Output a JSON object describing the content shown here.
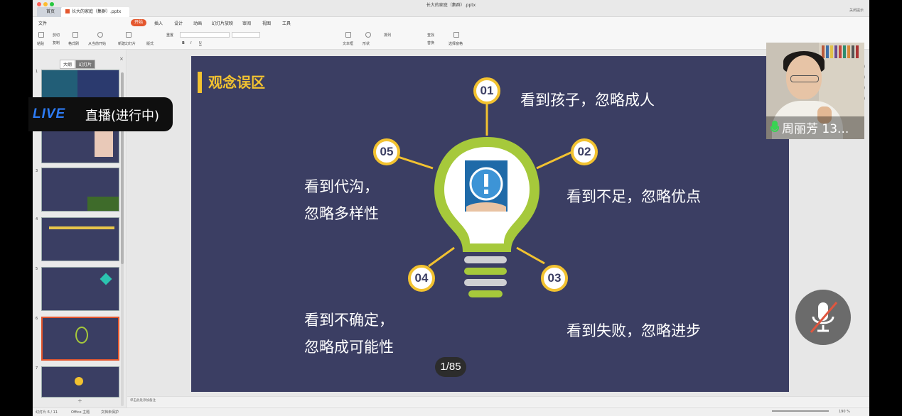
{
  "window": {
    "title": "长大的家庭（集群）.pptx",
    "home_tab": "首页",
    "doc_tab": "长大的家庭（集群）.pptx",
    "top_right": "关闭提示"
  },
  "menu": {
    "file": "文件",
    "start": "开始",
    "insert": "插入",
    "design": "设计",
    "animation": "动画",
    "slideshow": "幻灯片放映",
    "review": "审阅",
    "view": "视图",
    "tools": "工具"
  },
  "ribbon": {
    "cut": "剪切",
    "copy": "复制",
    "paste": "粘贴",
    "format_painter": "格式刷",
    "from_current": "从当前开始",
    "new_slide": "新建幻灯片",
    "layout": "版式",
    "reset": "重置",
    "textbox": "文本框",
    "shape": "形状",
    "arrange": "排列",
    "find": "查找",
    "replace": "替换",
    "select_window": "选择窗格"
  },
  "left_pane": {
    "tab_outline": "大纲",
    "tab_slides": "幻灯片",
    "slide_numbers": [
      "1",
      "2",
      "3",
      "4",
      "5",
      "6",
      "7"
    ],
    "selected_slide": 6
  },
  "notes": {
    "placeholder": "单击此处添加备注"
  },
  "statusbar": {
    "slide_info": "幻灯片 6 / 11",
    "theme": "Office 主题",
    "protect": "文档未保护",
    "zoom": "190 %"
  },
  "slide": {
    "title": "观念误区",
    "points": [
      {
        "num": "01",
        "text": "看到孩子，忽略成人"
      },
      {
        "num": "02",
        "text": "看到不足，忽略优点"
      },
      {
        "num": "03",
        "text": "看到失败，忽略进步"
      },
      {
        "num": "04",
        "text_line1": "看到不确定，",
        "text_line2": "忽略成可能性"
      },
      {
        "num": "05",
        "text_line1": "看到代沟，",
        "text_line2": "忽略多样性"
      }
    ],
    "accent_color": "#f2c230",
    "bulb_color": "#a6c93b",
    "background_color": "#3b3e63"
  },
  "page_counter": "1/85",
  "live": {
    "badge": "LIVE",
    "status": "直播(进行中)"
  },
  "video": {
    "name": "周丽芳 13..."
  },
  "mute_button": {
    "icon": "mic-off-icon"
  }
}
